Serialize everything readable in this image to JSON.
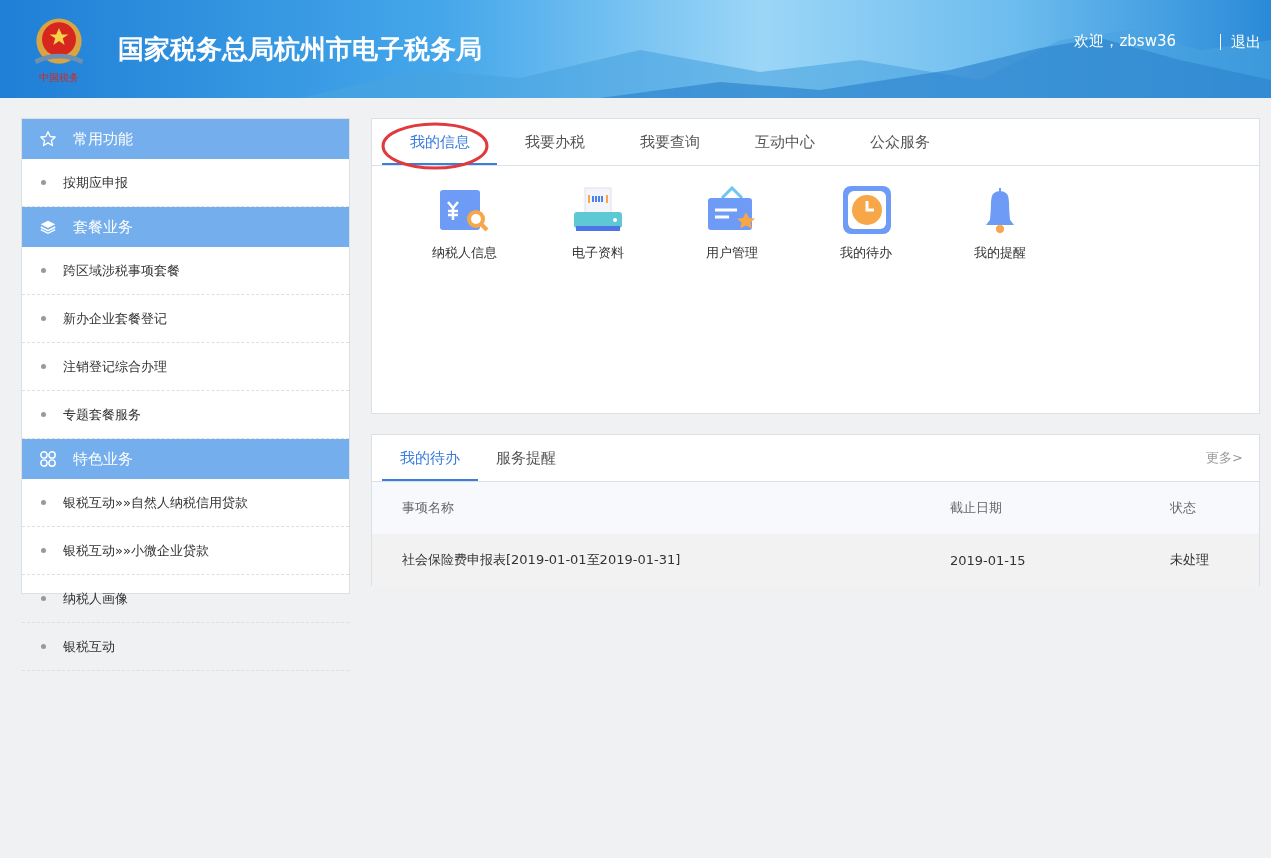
{
  "header": {
    "title": "国家税务总局杭州市电子税务局",
    "emblem_caption": "中国税务",
    "welcome": "欢迎，zbsw36",
    "logout": "退出"
  },
  "sidebar": {
    "sections": [
      {
        "title": "常用功能",
        "kind": "star",
        "items": [
          "按期应申报"
        ]
      },
      {
        "title": "套餐业务",
        "kind": "layers",
        "items": [
          "跨区域涉税事项套餐",
          "新办企业套餐登记",
          "注销登记综合办理",
          "专题套餐服务"
        ]
      },
      {
        "title": "特色业务",
        "kind": "grid",
        "items": [
          "银税互动»»自然人纳税信用贷款",
          "银税互动»»小微企业贷款",
          "纳税人画像",
          "银税互动"
        ]
      }
    ]
  },
  "main_tabs": [
    {
      "label": "我的信息",
      "selected": true
    },
    {
      "label": "我要办税",
      "selected": false
    },
    {
      "label": "我要查询",
      "selected": false
    },
    {
      "label": "互动中心",
      "selected": false
    },
    {
      "label": "公众服务",
      "selected": false
    }
  ],
  "shortcuts": [
    {
      "label": "纳税人信息",
      "kind": "receipt"
    },
    {
      "label": "电子资料",
      "kind": "printer"
    },
    {
      "label": "用户管理",
      "kind": "card"
    },
    {
      "label": "我的待办",
      "kind": "clock"
    },
    {
      "label": "我的提醒",
      "kind": "bell"
    }
  ],
  "task_tabs": [
    {
      "label": "我的待办",
      "selected": true
    },
    {
      "label": "服务提醒",
      "selected": false
    }
  ],
  "more_link": "更多>",
  "table": {
    "columns": [
      "事项名称",
      "截止日期",
      "状态"
    ],
    "rows": [
      {
        "cells": [
          "社会保险费申报表[2019-01-01至2019-01-31]",
          "2019-01-15",
          "未处理"
        ],
        "highlighted": true
      }
    ]
  }
}
